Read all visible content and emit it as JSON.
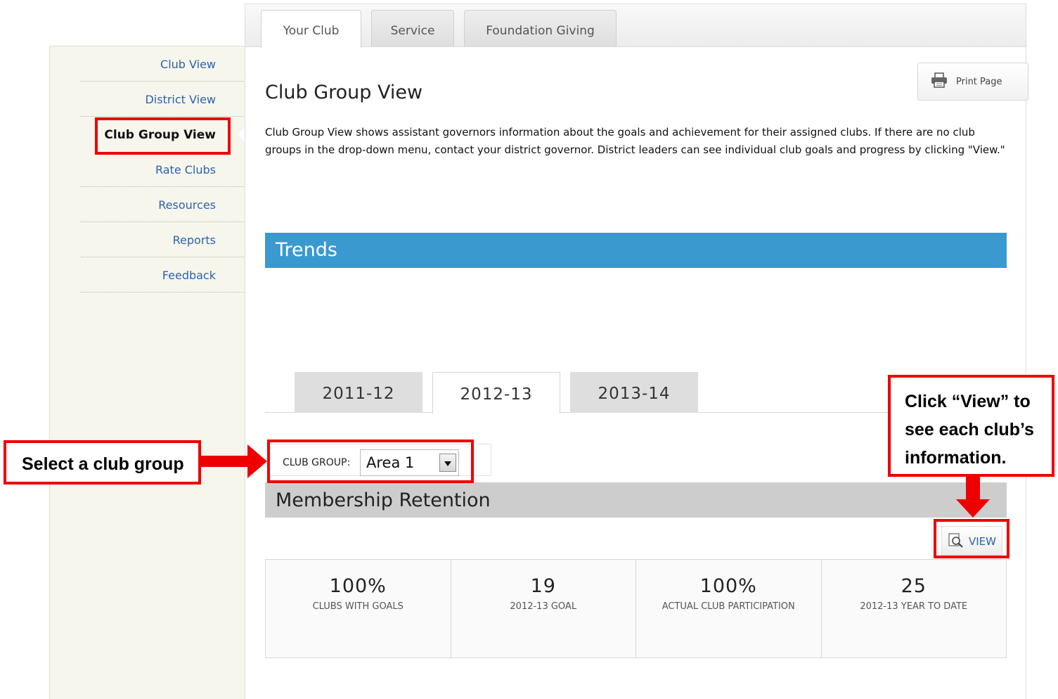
{
  "top_tabs": [
    {
      "label": "Your Club",
      "active": true
    },
    {
      "label": "Service",
      "active": false
    },
    {
      "label": "Foundation Giving",
      "active": false
    }
  ],
  "sidebar": {
    "items": [
      {
        "label": "Club View"
      },
      {
        "label": "District View"
      },
      {
        "label": "Club Group View",
        "active": true
      },
      {
        "label": "Rate Clubs"
      },
      {
        "label": "Resources"
      },
      {
        "label": "Reports"
      },
      {
        "label": "Feedback"
      }
    ]
  },
  "toolbar": {
    "print_label": "Print Page"
  },
  "page": {
    "title": "Club Group View",
    "description": "Club Group View shows assistant governors information about the goals and achievement for their assigned clubs. If there are no club groups in the drop-down menu, contact your district governor. District leaders can see individual club goals and progress by clicking \"View.\""
  },
  "trends": {
    "heading": "Trends"
  },
  "year_tabs": [
    {
      "label": "2011-12"
    },
    {
      "label": "2012-13",
      "active": true
    },
    {
      "label": "2013-14"
    }
  ],
  "club_group": {
    "label": "CLUB GROUP:",
    "selected": "Area 1"
  },
  "membership": {
    "heading": "Membership Retention",
    "view_label": "VIEW"
  },
  "stats": [
    {
      "value": "100%",
      "caption": "CLUBS WITH GOALS"
    },
    {
      "value": "19",
      "caption": "2012-13 GOAL"
    },
    {
      "value": "100%",
      "caption": "ACTUAL CLUB PARTICIPATION"
    },
    {
      "value": "25",
      "caption": "2012-13 YEAR TO DATE"
    }
  ],
  "annotations": {
    "select_text": "Select a club group",
    "view_text_1": "Click “View” to",
    "view_text_2": "see each club’s",
    "view_text_3": "information."
  },
  "colors": {
    "accent": "#3a99cf",
    "link": "#2a63ad",
    "annotation": "#ee0000"
  }
}
